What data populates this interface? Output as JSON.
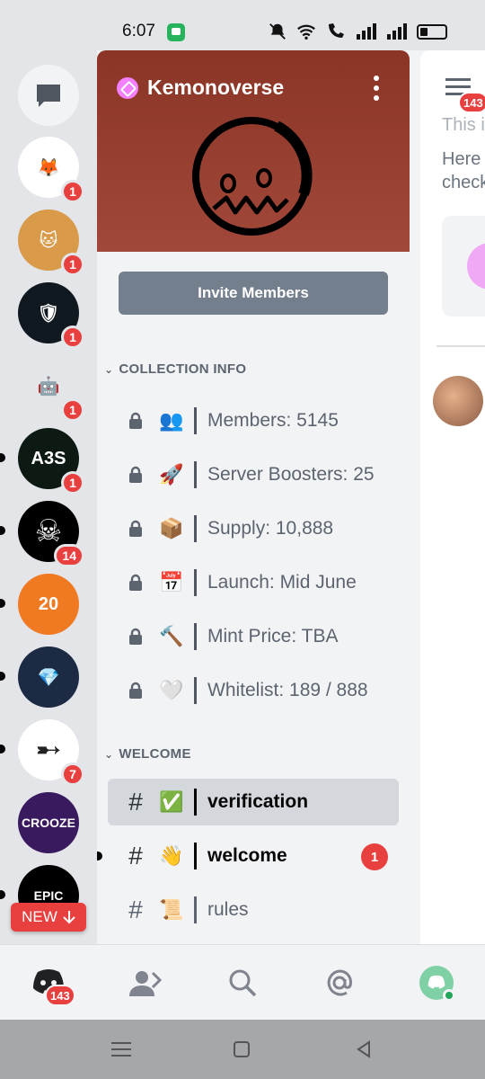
{
  "status_bar": {
    "time": "6:07"
  },
  "rail": {
    "dm_icon": "chat-bubble-icon",
    "guilds": [
      {
        "name": "fox-guild",
        "badge": "1",
        "bg": "#ffffff",
        "glyph": "🦊",
        "unread": false
      },
      {
        "name": "cat-guild",
        "badge": "1",
        "bg": "#d99a4a",
        "glyph": "🐱",
        "unread": false
      },
      {
        "name": "shield-guild",
        "badge": "1",
        "bg": "#101820",
        "glyph": "🛡",
        "unread": false
      },
      {
        "name": "robot-guild",
        "badge": "1",
        "bg": "#e3e5e8",
        "glyph": "🤖",
        "unread": false
      },
      {
        "name": "a3s-guild",
        "badge": "1",
        "bg": "#0d1a14",
        "glyph": "A3S",
        "unread": true
      },
      {
        "name": "skull-guild",
        "badge": "14",
        "bg": "#000000",
        "glyph": "☠",
        "unread": true
      },
      {
        "name": "football-guild",
        "badge": "",
        "bg": "#f07a22",
        "glyph": "20",
        "unread": true
      },
      {
        "name": "crystal-guild",
        "badge": "",
        "bg": "#1c2a44",
        "glyph": "💎",
        "unread": true
      },
      {
        "name": "bullet-guild",
        "badge": "7",
        "bg": "#ffffff",
        "glyph": "➸",
        "unread": true
      },
      {
        "name": "crooze-guild",
        "badge": "",
        "bg": "#3a1a5e",
        "glyph": "CROOZE",
        "unread": false
      },
      {
        "name": "epic-guild",
        "badge": "",
        "bg": "#000000",
        "glyph": "EPIC",
        "unread": true
      }
    ],
    "new_pill": "NEW"
  },
  "server": {
    "name": "Kemonoverse",
    "invite_label": "Invite Members",
    "categories": [
      {
        "label": "COLLECTION INFO"
      },
      {
        "label": "WELCOME"
      }
    ],
    "locked_channels": [
      {
        "emoji": "👥",
        "name": "Members: 5145"
      },
      {
        "emoji": "🚀",
        "name": "Server Boosters: 25"
      },
      {
        "emoji": "📦",
        "name": "Supply: 10,888"
      },
      {
        "emoji": "📅",
        "name": "Launch: Mid June"
      },
      {
        "emoji": "🔨",
        "name": "Mint Price: TBA"
      },
      {
        "emoji": "🤍",
        "name": "Whitelist: 189 / 888"
      }
    ],
    "text_channels": [
      {
        "emoji": "✅",
        "name": "verification",
        "badge": ""
      },
      {
        "emoji": "👋",
        "name": "welcome",
        "badge": "1"
      },
      {
        "emoji": "📜",
        "name": "rules",
        "badge": ""
      }
    ]
  },
  "peek": {
    "badge": "143",
    "line1": "This i",
    "line2": "Here",
    "line3": "check"
  },
  "tabbar": {
    "home_badge": "143"
  }
}
